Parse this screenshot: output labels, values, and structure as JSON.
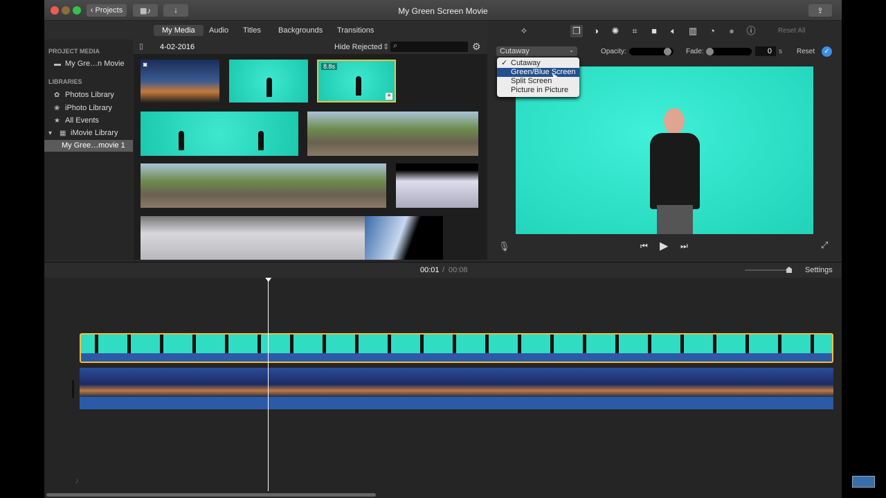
{
  "window": {
    "title": "My Green Screen Movie"
  },
  "toolbar": {
    "projects_label": "Projects"
  },
  "browser_tabs": [
    "My Media",
    "Audio",
    "Titles",
    "Backgrounds",
    "Transitions"
  ],
  "sidebar": {
    "project_media_header": "PROJECT MEDIA",
    "project_item": "My Gre…n Movie",
    "libraries_header": "LIBRARIES",
    "items": [
      "Photos Library",
      "iPhoto Library",
      "All Events",
      "iMovie Library"
    ],
    "selected_event": "My Gree…movie 1"
  },
  "browser": {
    "date": "4-02-2016",
    "filter": "Hide Rejected",
    "search_placeholder": "",
    "clip_duration": "8.8s"
  },
  "viewer": {
    "reset_all": "Reset All",
    "overlay_mode": "Cutaway",
    "opacity_label": "Opacity:",
    "fade_label": "Fade:",
    "fade_value": "0",
    "fade_unit": "s",
    "reset_label": "Reset",
    "opacity": 0.95,
    "fade": 0,
    "menu": [
      {
        "label": "Cutaway",
        "checked": true
      },
      {
        "label": "Green/Blue Screen",
        "highlighted": true
      },
      {
        "label": "Split Screen"
      },
      {
        "label": "Picture in Picture"
      }
    ]
  },
  "timeline": {
    "current_time": "00:01",
    "separator": "/",
    "total_time": "00:08",
    "settings_label": "Settings",
    "playhead_fraction": 0.25
  }
}
